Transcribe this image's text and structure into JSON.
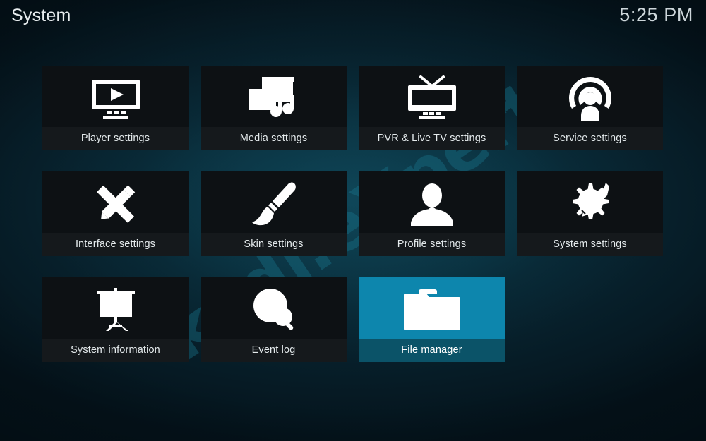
{
  "header": {
    "title": "System",
    "clock": "5:25 PM"
  },
  "watermark": {
    "text": "kodi.eXpert"
  },
  "theme": {
    "accent": "#0d86ad",
    "accent_dark": "#0b5368",
    "tile_bg": "#0d1114",
    "tile_label_bg": "#15191c",
    "text": "#e4eaec",
    "background": "#0a303e"
  },
  "grid": {
    "tiles": [
      {
        "label": "Player settings",
        "icon": "monitor-play-icon",
        "selected": false
      },
      {
        "label": "Media settings",
        "icon": "film-photo-music-icon",
        "selected": false
      },
      {
        "label": "PVR & Live TV settings",
        "icon": "tv-antenna-icon",
        "selected": false
      },
      {
        "label": "Service settings",
        "icon": "broadcast-person-icon",
        "selected": false
      },
      {
        "label": "Interface settings",
        "icon": "pencil-ruler-icon",
        "selected": false
      },
      {
        "label": "Skin settings",
        "icon": "paintbrush-icon",
        "selected": false
      },
      {
        "label": "Profile settings",
        "icon": "person-icon",
        "selected": false
      },
      {
        "label": "System settings",
        "icon": "gear-screwdriver-icon",
        "selected": false
      },
      {
        "label": "System information",
        "icon": "presentation-chart-icon",
        "selected": false
      },
      {
        "label": "Event log",
        "icon": "clock-search-icon",
        "selected": false
      },
      {
        "label": "File manager",
        "icon": "folder-icon",
        "selected": true
      }
    ]
  }
}
